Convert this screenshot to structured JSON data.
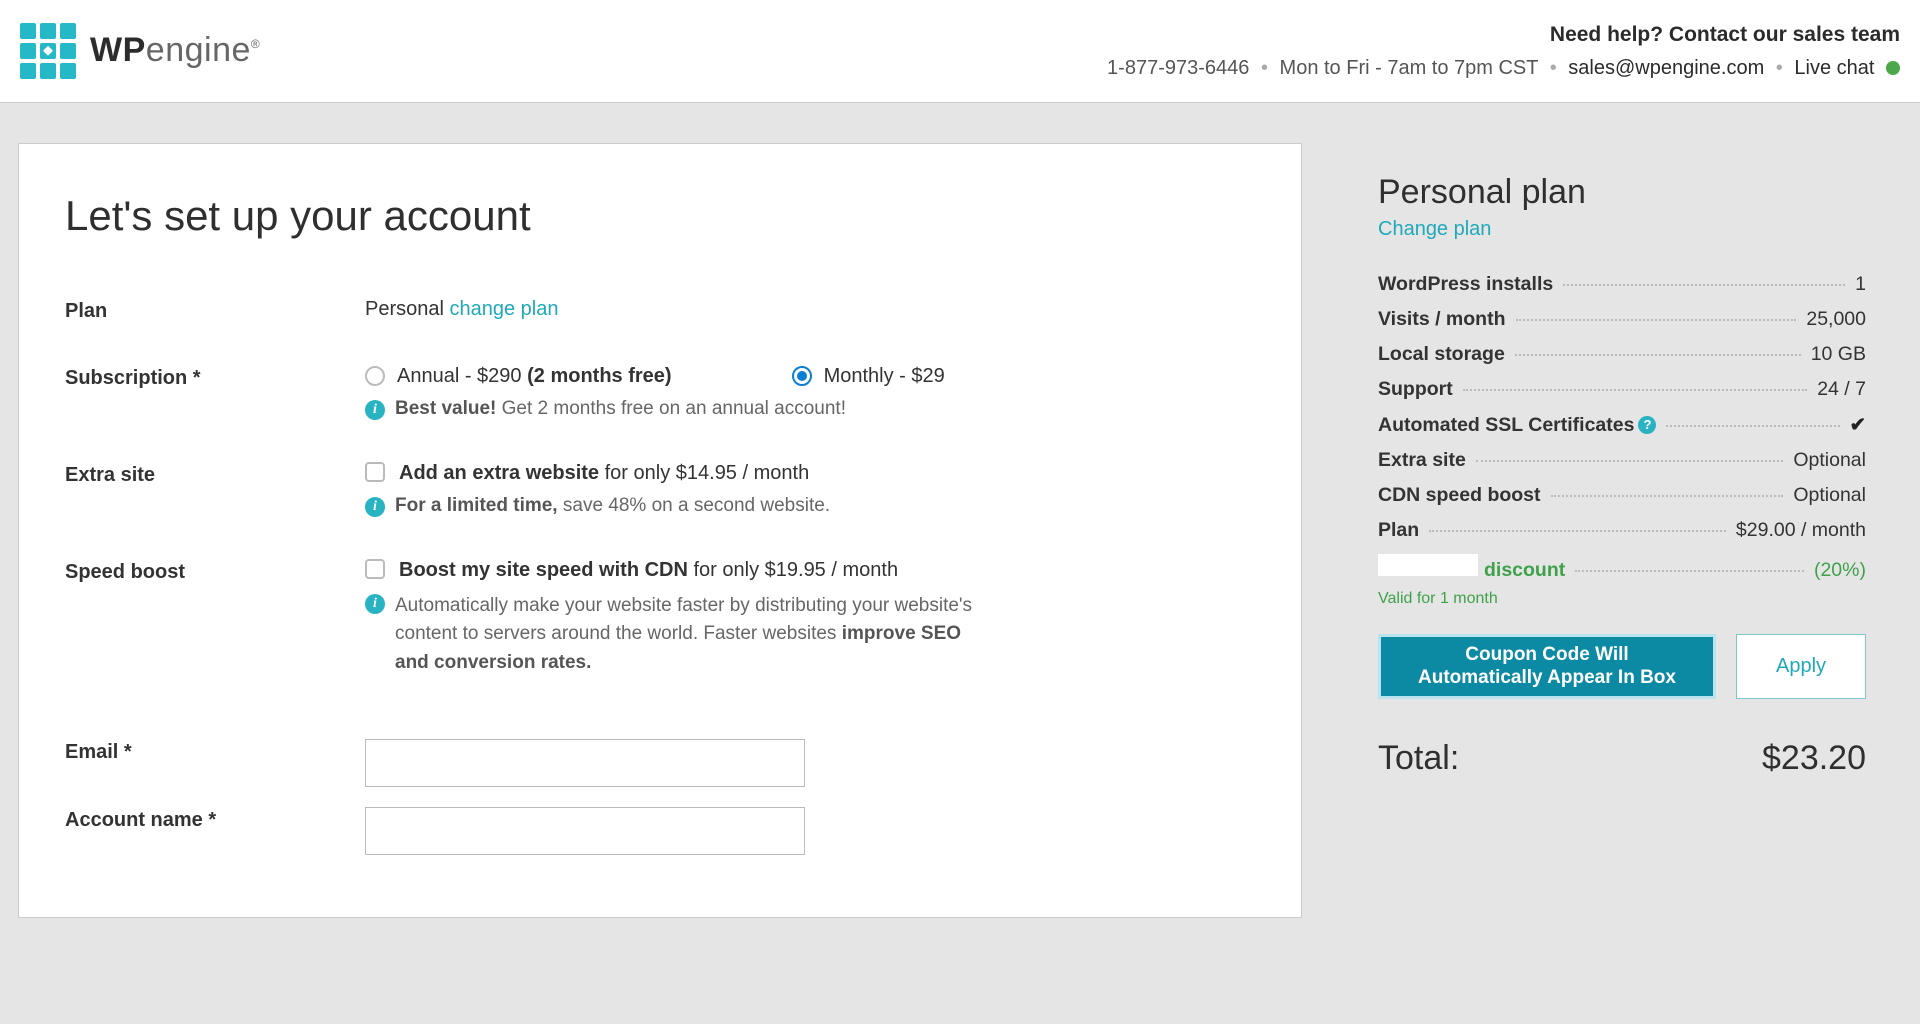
{
  "header": {
    "brand_bold": "WP",
    "brand_light": "engine",
    "help_heading": "Need help? Contact our sales team",
    "phone": "1-877-973-6446",
    "hours": "Mon to Fri - 7am to 7pm CST",
    "email": "sales@wpengine.com",
    "live_chat": "Live chat"
  },
  "main": {
    "title": "Let's set up your account",
    "plan_label": "Plan",
    "plan_value": "Personal",
    "change_plan": "change plan",
    "subscription_label": "Subscription *",
    "sub_annual_prefix": "Annual - $290",
    "sub_annual_suffix": " (2 months free)",
    "sub_monthly": "Monthly - $29",
    "sub_info_bold": "Best value!",
    "sub_info_rest": " Get 2 months free on an annual account!",
    "extra_label": "Extra site",
    "extra_bold": "Add an extra website",
    "extra_rest": " for only $14.95 / month",
    "extra_info_bold": "For a limited time,",
    "extra_info_rest": " save 48% on a second website.",
    "speed_label": "Speed boost",
    "speed_bold": "Boost my site speed with CDN",
    "speed_rest": " for only $19.95 / month",
    "speed_desc_1": "Automatically make your website faster by distributing your website's content to servers around the world. Faster websites ",
    "speed_desc_bold": "improve SEO and conversion rates.",
    "email_label": "Email *",
    "account_label": "Account name *"
  },
  "sidebar": {
    "title": "Personal plan",
    "change_plan": "Change plan",
    "rows": {
      "installs_k": "WordPress installs",
      "installs_v": "1",
      "visits_k": "Visits / month",
      "visits_v": "25,000",
      "storage_k": "Local storage",
      "storage_v": "10 GB",
      "support_k": "Support",
      "support_v": "24 / 7",
      "ssl_k": "Automated SSL Certificates",
      "extra_k": "Extra site",
      "extra_v": "Optional",
      "cdn_k": "CDN speed boost",
      "cdn_v": "Optional",
      "plan_k": "Plan",
      "plan_v": "$29.00 / month",
      "discount_k": "discount",
      "discount_v": "(20%)"
    },
    "valid_note": "Valid for 1 month",
    "coupon_l1": "Coupon Code Will",
    "coupon_l2": "Automatically Appear In Box",
    "apply": "Apply",
    "total_label": "Total:",
    "total_value": "$23.20"
  }
}
